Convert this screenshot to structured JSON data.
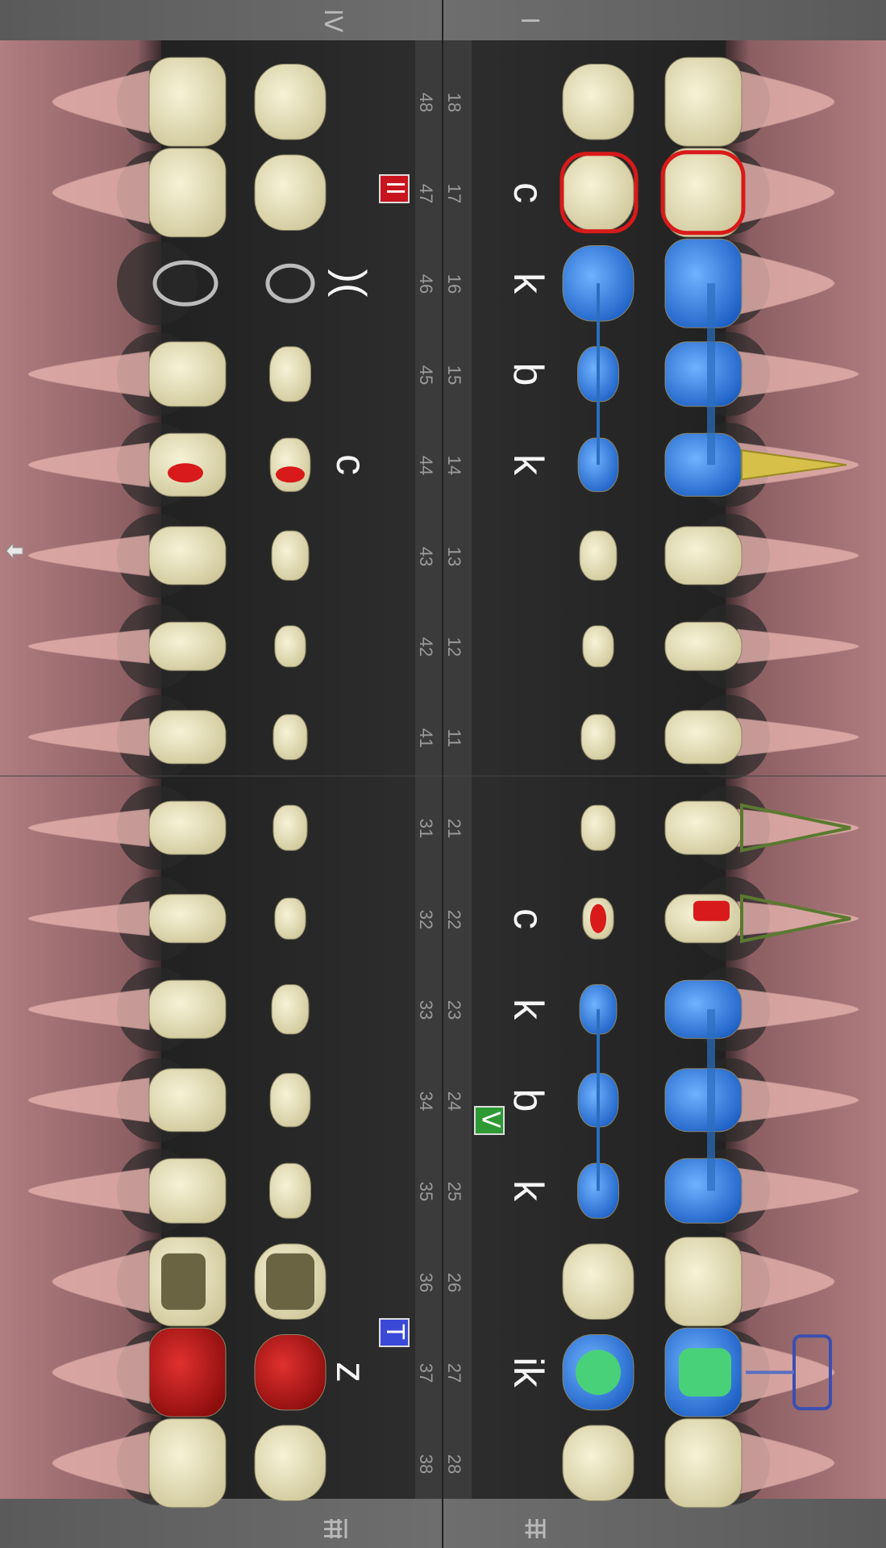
{
  "quadrant_labels": {
    "upper_right": "I",
    "upper_left": "II",
    "lower_left": "III",
    "lower_right": "IV"
  },
  "upper_numbers": [
    "18",
    "17",
    "16",
    "15",
    "14",
    "13",
    "12",
    "11",
    "21",
    "22",
    "23",
    "24",
    "25",
    "26",
    "27",
    "28"
  ],
  "lower_numbers": [
    "48",
    "47",
    "46",
    "45",
    "44",
    "43",
    "42",
    "41",
    "31",
    "32",
    "33",
    "34",
    "35",
    "36",
    "37",
    "38"
  ],
  "upper_marks": [
    "",
    "c",
    "k",
    "b",
    "k",
    "",
    "",
    "",
    "",
    "c",
    "k",
    "b",
    "k",
    "",
    "ik",
    ""
  ],
  "lower_marks": [
    "",
    "",
    ")(",
    "",
    "c",
    "",
    "",
    "",
    "",
    "",
    "",
    "",
    "",
    "",
    "z",
    ""
  ],
  "badges": {
    "tooth_47": {
      "label": "II",
      "color": "#c8141e"
    },
    "tooth_24": {
      "label": "V",
      "color": "#2e9a33"
    },
    "tooth_37": {
      "label": "T",
      "color": "#3a49d8"
    }
  },
  "colors": {
    "tooth": "#e6e0b8",
    "crown_blue": "#2f7fe0",
    "alert_red": "#d81a1a",
    "filling_green": "#49d17a",
    "root_pink": "#e6b2ae",
    "gum": "#a67276",
    "background": "#1a1a1a"
  },
  "icons": {
    "side_toggle": "arrow-left-icon",
    "menu_bottom": "hamburger-menu-icon"
  }
}
